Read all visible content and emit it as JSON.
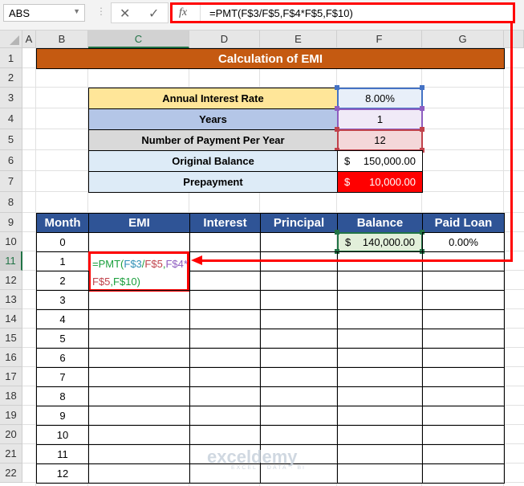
{
  "name_box": "ABS",
  "formula_bar": {
    "fx_label": "fx",
    "formula": "=PMT(F$3/F$5,F$4*F$5,F$10)",
    "cancel_icon": "✕",
    "enter_icon": "✓"
  },
  "columns": [
    "A",
    "B",
    "C",
    "D",
    "E",
    "F",
    "G"
  ],
  "rows": [
    "1",
    "2",
    "3",
    "4",
    "5",
    "6",
    "7",
    "8",
    "9",
    "10",
    "11",
    "12",
    "13",
    "14",
    "15",
    "16",
    "17",
    "18",
    "19",
    "20",
    "21",
    "22"
  ],
  "title": "Calculation of EMI",
  "inputs": [
    {
      "label": "Annual Interest Rate",
      "value": "8.00%"
    },
    {
      "label": "Years",
      "value": "1"
    },
    {
      "label": "Number of Payment Per Year",
      "value": "12"
    },
    {
      "label": "Original Balance",
      "currency": "$",
      "value": "150,000.00"
    },
    {
      "label": "Prepayment",
      "currency": "$",
      "value": "10,000.00"
    }
  ],
  "table": {
    "headers": [
      "Month",
      "EMI",
      "Interest",
      "Principal",
      "Balance",
      "Paid Loan"
    ],
    "months": [
      "0",
      "1",
      "2",
      "3",
      "4",
      "5",
      "6",
      "7",
      "8",
      "9",
      "10",
      "11",
      "12"
    ],
    "row0": {
      "balance_currency": "$",
      "balance": "140,000.00",
      "paid_loan": "0.00%"
    },
    "editing_formula": {
      "p1": "=PMT(",
      "p2": "F$3",
      "p3": "/",
      "p4": "F$5",
      "p5": ",",
      "p6": "F$4*",
      "p7": "F$5",
      "p8": ",",
      "p9": "F$10",
      "p10": ")"
    }
  },
  "watermark": {
    "name": "exceldemy",
    "tagline": "EXCEL · DATA · BI"
  },
  "colors": {
    "title": "#C55A11",
    "header": "#2F5496",
    "highlight": "#FF0000"
  }
}
